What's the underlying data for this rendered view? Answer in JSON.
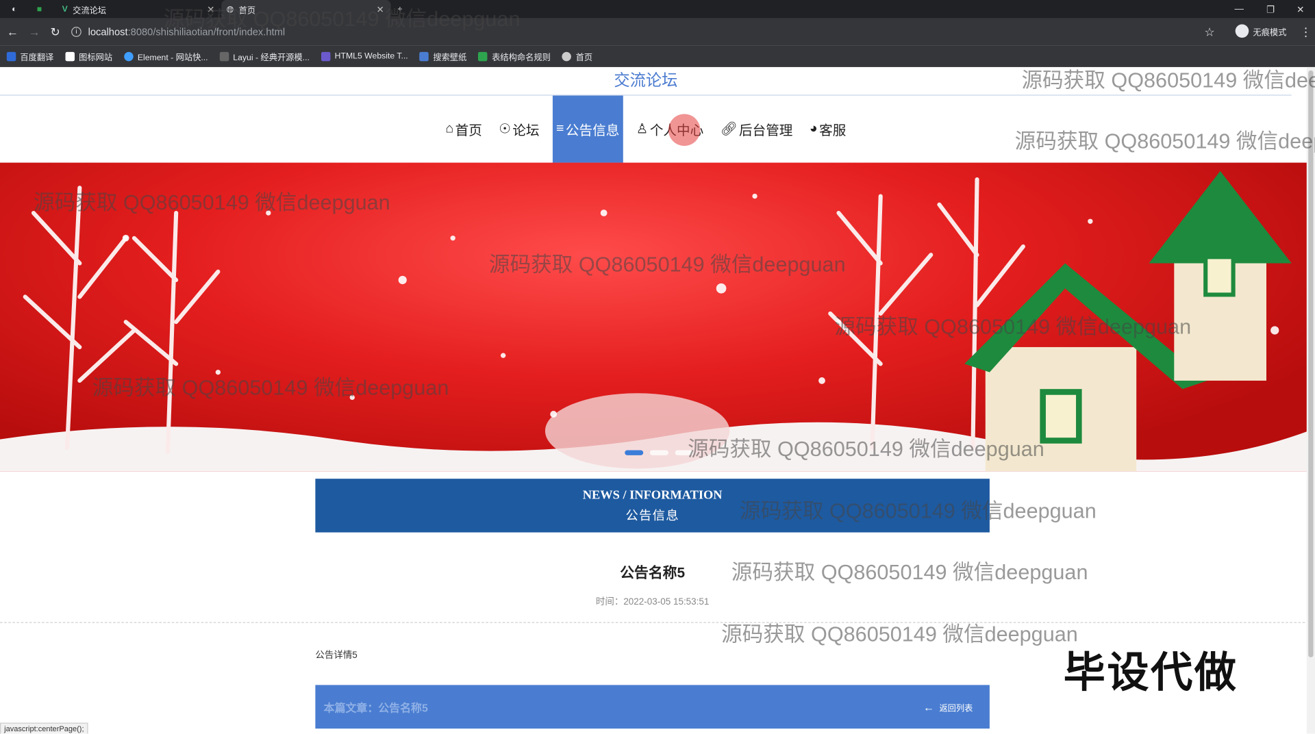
{
  "browser": {
    "tabs": [
      {
        "title": "",
        "icon": "google-icon"
      },
      {
        "title": "",
        "icon": "sheet-icon"
      },
      {
        "title": "交流论坛",
        "icon": "vue-icon"
      },
      {
        "title": "首页",
        "icon": "globe-icon"
      }
    ],
    "url_host": "localhost",
    "url_path": ":8080/shishiliaotian/front/index.html",
    "profile_label": "无痕模式",
    "bookmarks": [
      "百度翻译",
      "图标网站",
      "Element - 网站快...",
      "Layui - 经典开源模...",
      "HTML5 Website T...",
      "搜索壁纸",
      "表结构命名规则",
      "首页"
    ],
    "status_text": "javascript:centerPage();"
  },
  "site": {
    "title": "交流论坛",
    "nav": [
      {
        "label": "首页",
        "icon": "home-icon"
      },
      {
        "label": "论坛",
        "icon": "forum-icon"
      },
      {
        "label": "公告信息",
        "icon": "list-icon"
      },
      {
        "label": "个人中心",
        "icon": "user-icon"
      },
      {
        "label": "后台管理",
        "icon": "link-icon"
      },
      {
        "label": "客服",
        "icon": "service-icon"
      }
    ],
    "active_nav_index": 2
  },
  "carousel": {
    "slide_count": 3,
    "active_index": 0
  },
  "section": {
    "en": "NEWS / INFORMATION",
    "cn": "公告信息"
  },
  "announcement": {
    "title": "公告名称5",
    "time_label": "时间：",
    "time": "2022-03-05 15:53:51",
    "body": "公告详情5",
    "current_label": "本篇文章：",
    "current_title": "公告名称5",
    "back_label": "返回列表"
  },
  "watermark_text": "源码获取 QQ86050149 微信deepguan",
  "stamp_text": "毕设代做",
  "colors": {
    "accent": "#4a7dd1",
    "header": "#1e5aa0",
    "title": "#4b7bd0"
  }
}
